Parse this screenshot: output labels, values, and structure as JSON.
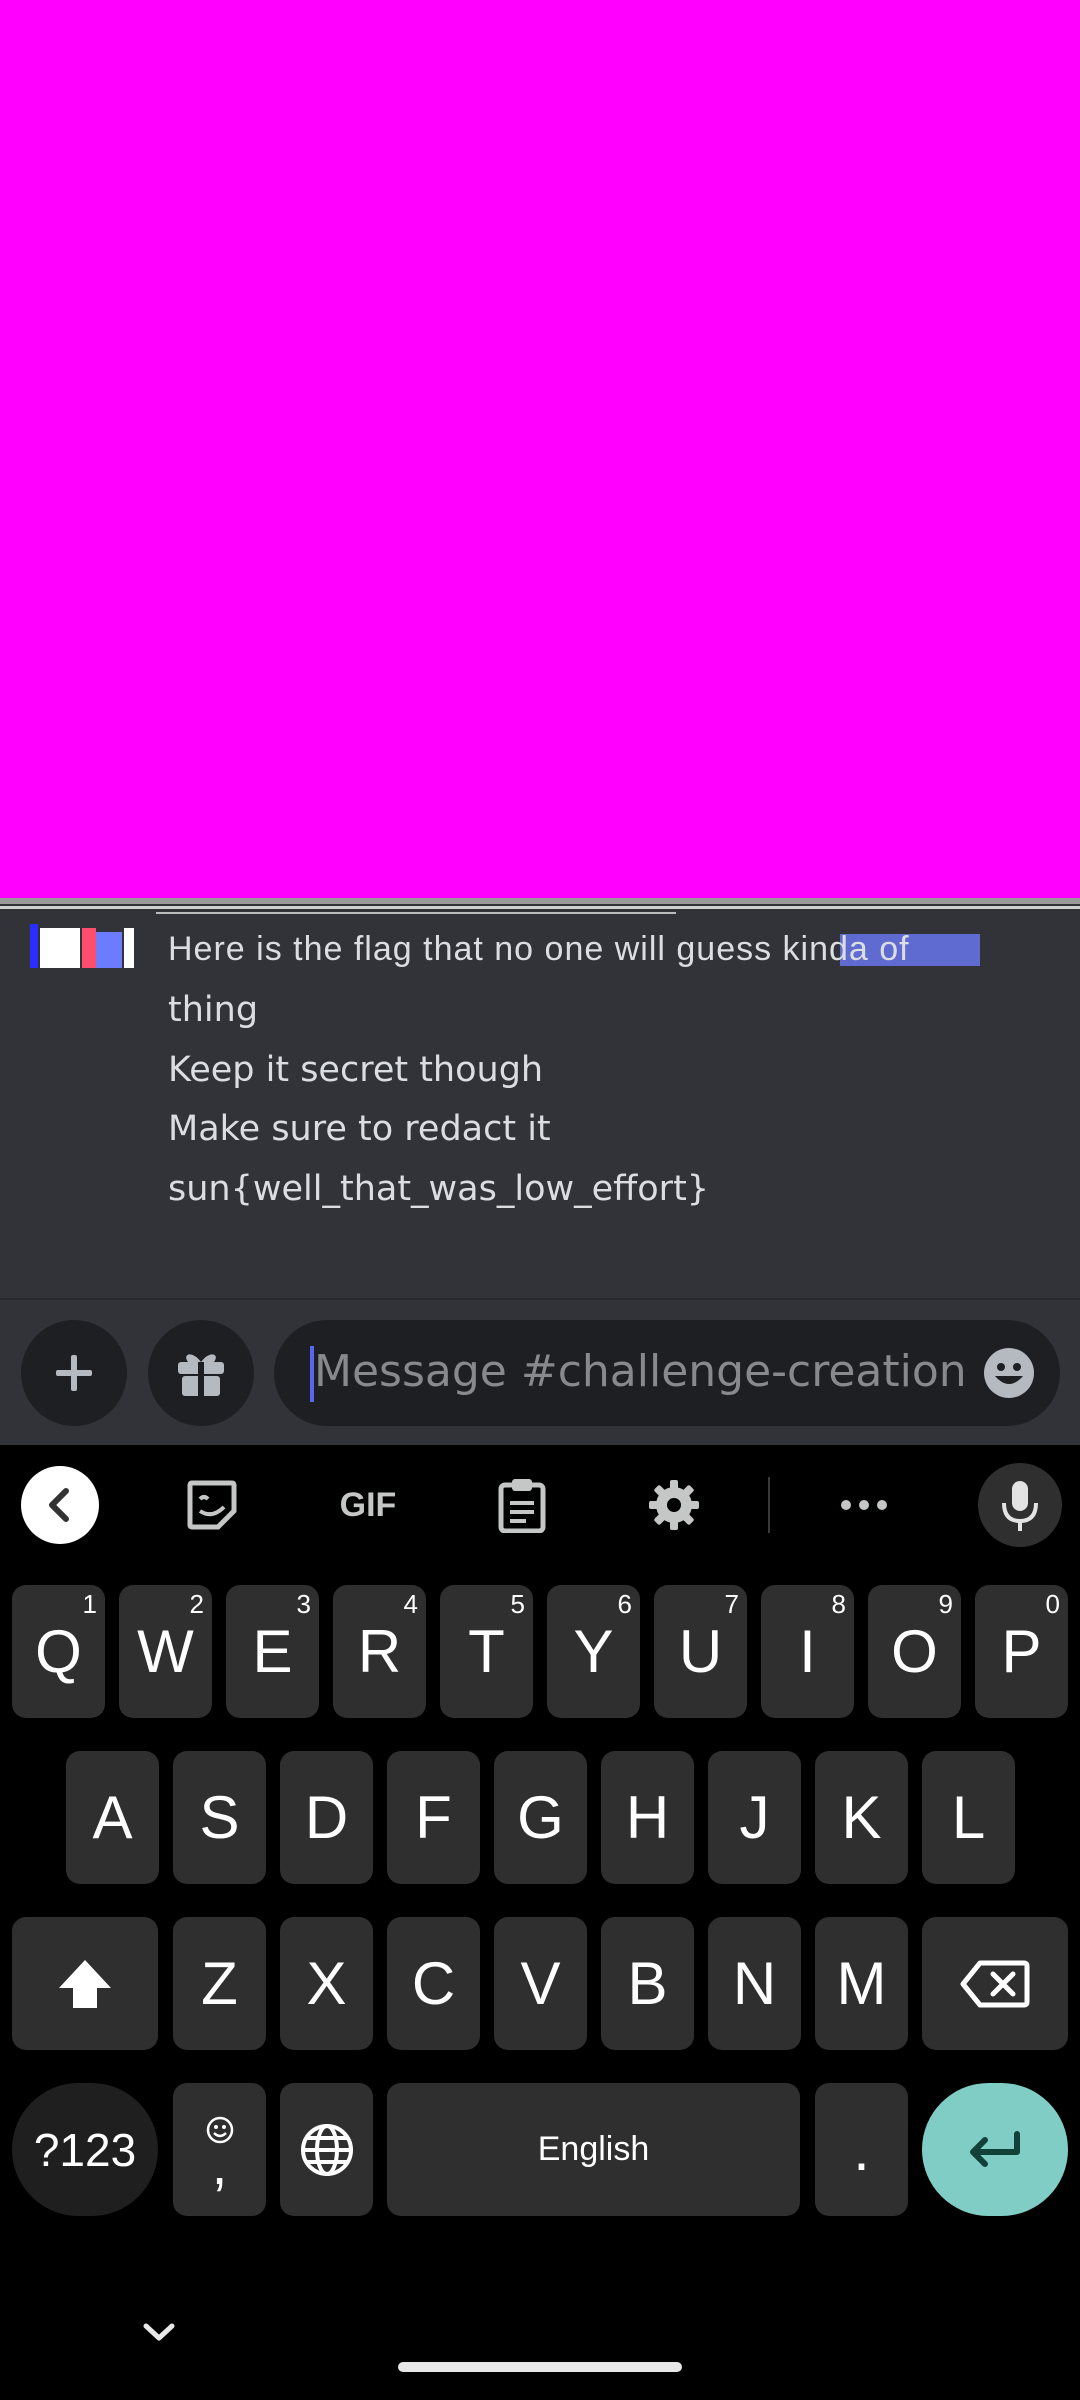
{
  "chat": {
    "glitched_line": "Here is the flag that no one will guess kinda of",
    "lines": [
      "thing",
      "Keep it secret though",
      "Make sure to redact it",
      "sun{well_that_was_low_effort}"
    ]
  },
  "composer": {
    "placeholder": "Message #challenge-creation",
    "icons": [
      "plus-icon",
      "gift-icon",
      "emoji-icon"
    ]
  },
  "keyboard": {
    "toolbar": {
      "gif_label": "GIF",
      "icons": [
        "back-chevron-icon",
        "sticker-icon",
        "clipboard-icon",
        "settings-icon",
        "more-icon",
        "microphone-icon"
      ]
    },
    "row1": [
      {
        "key": "Q",
        "hint": "1"
      },
      {
        "key": "W",
        "hint": "2"
      },
      {
        "key": "E",
        "hint": "3"
      },
      {
        "key": "R",
        "hint": "4"
      },
      {
        "key": "T",
        "hint": "5"
      },
      {
        "key": "Y",
        "hint": "6"
      },
      {
        "key": "U",
        "hint": "7"
      },
      {
        "key": "I",
        "hint": "8"
      },
      {
        "key": "O",
        "hint": "9"
      },
      {
        "key": "P",
        "hint": "0"
      }
    ],
    "row2": [
      "A",
      "S",
      "D",
      "F",
      "G",
      "H",
      "J",
      "K",
      "L"
    ],
    "row3": [
      "Z",
      "X",
      "C",
      "V",
      "B",
      "N",
      "M"
    ],
    "symbols_label": "?123",
    "comma_label": ",",
    "space_label": "English",
    "period_label": ".",
    "colors": {
      "enter_key": "#7fcdc4",
      "redaction": "#ff00ff"
    }
  }
}
